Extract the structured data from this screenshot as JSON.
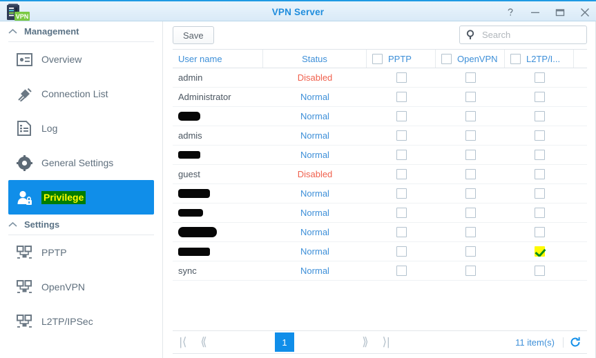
{
  "window": {
    "title": "VPN Server",
    "app_icon": "nas-vpn-icon",
    "controls": [
      {
        "name": "help-button",
        "glyph": "?"
      },
      {
        "name": "minimize-button",
        "glyph": "–"
      },
      {
        "name": "maximize-button",
        "glyph": "□"
      },
      {
        "name": "close-button",
        "glyph": "✕"
      }
    ]
  },
  "sidebar": {
    "sections": [
      {
        "label": "Management",
        "items": [
          {
            "label": "Overview",
            "icon": "overview-card-icon",
            "selected": false,
            "highlighted": false
          },
          {
            "label": "Connection List",
            "icon": "plug-connection-icon",
            "selected": false,
            "highlighted": false
          },
          {
            "label": "Log",
            "icon": "log-document-icon",
            "selected": false,
            "highlighted": false
          },
          {
            "label": "General Settings",
            "icon": "gear-icon",
            "selected": false,
            "highlighted": false
          },
          {
            "label": "Privilege",
            "icon": "user-lock-icon",
            "selected": true,
            "highlighted": true
          }
        ]
      },
      {
        "label": "Settings",
        "items": [
          {
            "label": "PPTP",
            "icon": "network-computers-icon",
            "selected": false,
            "highlighted": false
          },
          {
            "label": "OpenVPN",
            "icon": "network-computers-icon",
            "selected": false,
            "highlighted": false
          },
          {
            "label": "L2TP/IPSec",
            "icon": "network-computers-icon",
            "selected": false,
            "highlighted": false
          }
        ]
      }
    ]
  },
  "toolbar": {
    "save_label": "Save",
    "search_placeholder": "Search",
    "search_value": ""
  },
  "table": {
    "columns": [
      {
        "key": "user",
        "label": "User name",
        "checkbox": false
      },
      {
        "key": "status",
        "label": "Status",
        "checkbox": false
      },
      {
        "key": "pptp",
        "label": "PPTP",
        "checkbox": true,
        "checked": false
      },
      {
        "key": "openvpn",
        "label": "OpenVPN",
        "checkbox": true,
        "checked": false
      },
      {
        "key": "l2tp",
        "label": "L2TP/I...",
        "checkbox": true,
        "checked": false
      }
    ],
    "rows": [
      {
        "user": "admin",
        "redacted": false,
        "status": "Disabled",
        "status_state": "disabled",
        "pptp": false,
        "openvpn": false,
        "l2tp": false,
        "l2tp_marked": false
      },
      {
        "user": "Administrator",
        "redacted": false,
        "status": "Normal",
        "status_state": "normal",
        "pptp": false,
        "openvpn": false,
        "l2tp": false,
        "l2tp_marked": false
      },
      {
        "user": "",
        "redacted": true,
        "redact_size": "w1",
        "status": "Normal",
        "status_state": "normal",
        "pptp": false,
        "openvpn": false,
        "l2tp": false,
        "l2tp_marked": false
      },
      {
        "user": "admis",
        "redacted": false,
        "status": "Normal",
        "status_state": "normal",
        "pptp": false,
        "openvpn": false,
        "l2tp": false,
        "l2tp_marked": false
      },
      {
        "user": "",
        "redacted": true,
        "redact_size": "w2",
        "status": "Normal",
        "status_state": "normal",
        "pptp": false,
        "openvpn": false,
        "l2tp": false,
        "l2tp_marked": false
      },
      {
        "user": "guest",
        "redacted": false,
        "status": "Disabled",
        "status_state": "disabled",
        "pptp": false,
        "openvpn": false,
        "l2tp": false,
        "l2tp_marked": false
      },
      {
        "user": "",
        "redacted": true,
        "redact_size": "w3",
        "status": "Normal",
        "status_state": "normal",
        "pptp": false,
        "openvpn": false,
        "l2tp": false,
        "l2tp_marked": false
      },
      {
        "user": "",
        "redacted": true,
        "redact_size": "w4",
        "status": "Normal",
        "status_state": "normal",
        "pptp": false,
        "openvpn": false,
        "l2tp": false,
        "l2tp_marked": false
      },
      {
        "user": "",
        "redacted": true,
        "redact_size": "w5",
        "status": "Normal",
        "status_state": "normal",
        "pptp": false,
        "openvpn": false,
        "l2tp": false,
        "l2tp_marked": false
      },
      {
        "user": "",
        "redacted": true,
        "redact_size": "w6",
        "status": "Normal",
        "status_state": "normal",
        "pptp": false,
        "openvpn": false,
        "l2tp": true,
        "l2tp_marked": true
      },
      {
        "user": "sync",
        "redacted": false,
        "status": "Normal",
        "status_state": "normal",
        "pptp": false,
        "openvpn": false,
        "l2tp": false,
        "l2tp_marked": false
      }
    ]
  },
  "pagination": {
    "first_glyph": "|⟨",
    "prev_glyph": "⟪",
    "current_page": "1",
    "next_glyph": "⟫",
    "last_glyph": "⟩|",
    "item_count": "11 item(s)",
    "refresh_icon": "refresh-icon"
  },
  "colors": {
    "accent": "#108ee9",
    "title": "#1f8ddd",
    "link": "#3d8fd8",
    "status_disabled": "#f0604d",
    "highlight_bg": "#017d01",
    "highlight_fg": "#fffb00",
    "marker_yellow": "#fffb00",
    "marker_green": "#0a8f18"
  }
}
